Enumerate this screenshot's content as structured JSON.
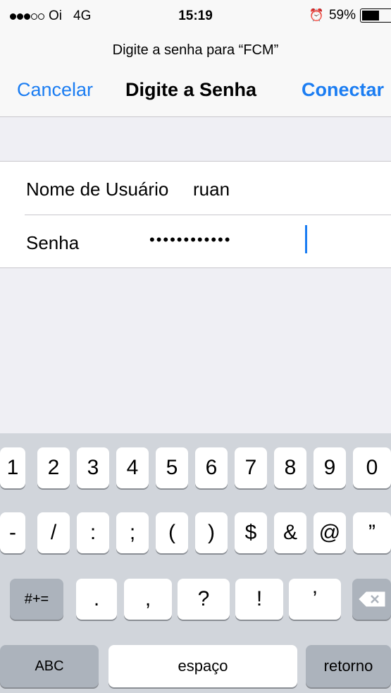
{
  "status_bar": {
    "carrier": "Oi",
    "network": "4G",
    "time": "15:19",
    "battery": "59%",
    "signal_dots_filled": 3,
    "signal_dots_total": 5
  },
  "prompt": "Digite a senha para “FCM”",
  "nav": {
    "cancel_label": "Cancelar",
    "title": "Digite a Senha",
    "connect_label": "Conectar"
  },
  "form": {
    "username_label": "Nome de Usuário",
    "username_value": "ruan",
    "password_label": "Senha",
    "password_value": "••••••••••••"
  },
  "keyboard": {
    "row1": [
      "1",
      "2",
      "3",
      "4",
      "5",
      "6",
      "7",
      "8",
      "9",
      "0"
    ],
    "row2": [
      "-",
      "/",
      ":",
      ";",
      "(",
      ")",
      "$",
      "&",
      "@",
      "”"
    ],
    "row3_mode_label": "#+=",
    "row3": [
      ".",
      ",",
      "?",
      "!",
      "’"
    ],
    "backspace_icon": "backspace-icon",
    "abc_label": "ABC",
    "space_label": "espaço",
    "return_label": "retorno"
  },
  "colors": {
    "accent": "#1b7df2",
    "keyboard_bg": "#d1d5db",
    "dark_key": "#acb3bc"
  }
}
